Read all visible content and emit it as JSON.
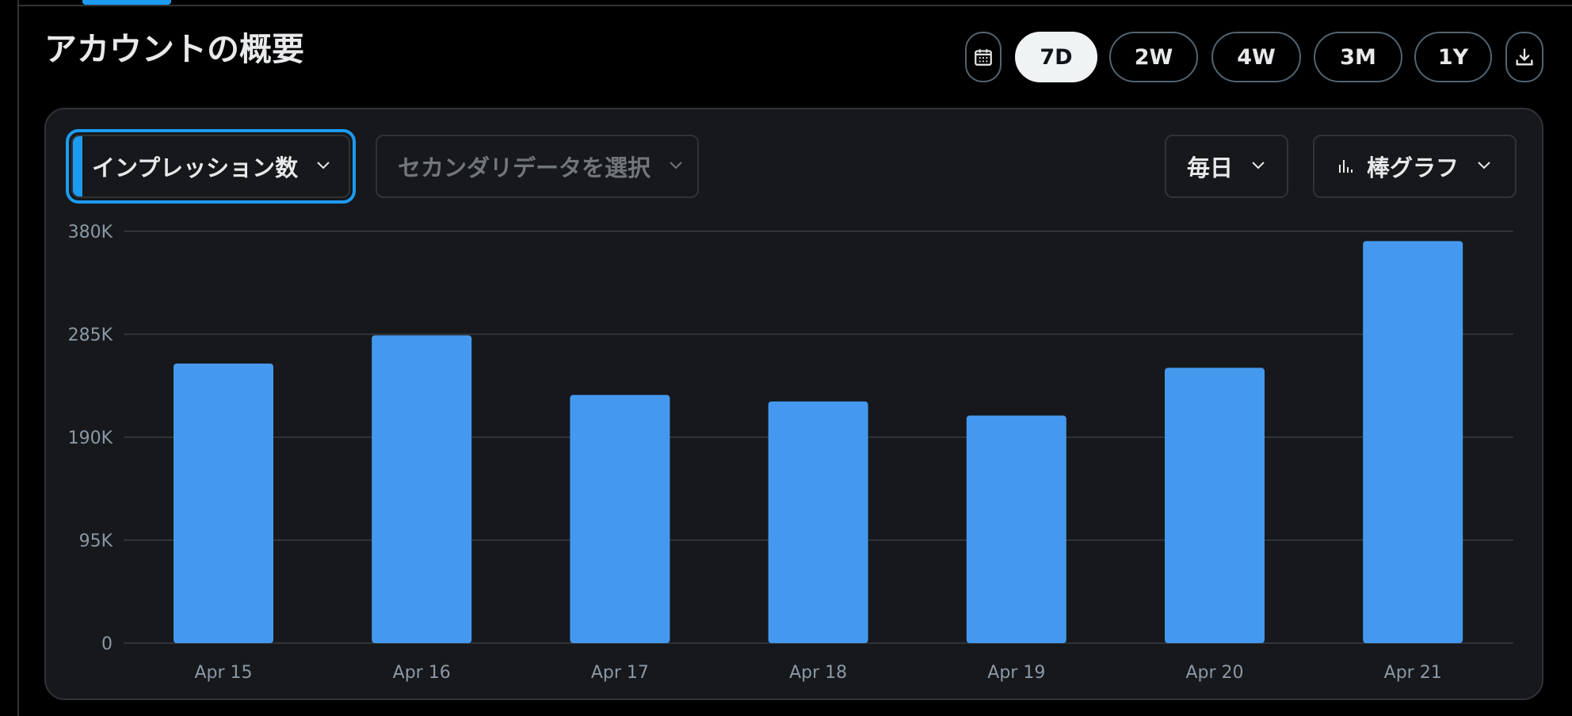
{
  "page": {
    "title": "アカウントの概要"
  },
  "range_buttons": {
    "calendar_icon": "calendar-icon",
    "items": [
      {
        "label": "7D",
        "active": true
      },
      {
        "label": "2W",
        "active": false
      },
      {
        "label": "4W",
        "active": false
      },
      {
        "label": "3M",
        "active": false
      },
      {
        "label": "1Y",
        "active": false
      }
    ],
    "download_icon": "download-icon"
  },
  "controls": {
    "primary_metric": "インプレッション数",
    "secondary_metric_placeholder": "セカンダリデータを選択",
    "granularity": "毎日",
    "chart_type": "棒グラフ",
    "chart_type_icon": "bar-chart-icon"
  },
  "colors": {
    "accent": "#1d9bf0",
    "bar": "#4499ee",
    "background": "#000000",
    "card": "#16181c",
    "border": "#2f3336"
  },
  "chart_data": {
    "type": "bar",
    "categories": [
      "Apr 15",
      "Apr 16",
      "Apr 17",
      "Apr 18",
      "Apr 19",
      "Apr 20",
      "Apr 21"
    ],
    "values": [
      258000,
      284000,
      229000,
      223000,
      210000,
      254000,
      371000
    ],
    "ylim": [
      0,
      380000
    ],
    "yticks": [
      0,
      95000,
      190000,
      285000,
      380000
    ],
    "ytick_labels": [
      "0",
      "95K",
      "190K",
      "285K",
      "380K"
    ],
    "grid": true,
    "title": "",
    "xlabel": "",
    "ylabel": ""
  }
}
